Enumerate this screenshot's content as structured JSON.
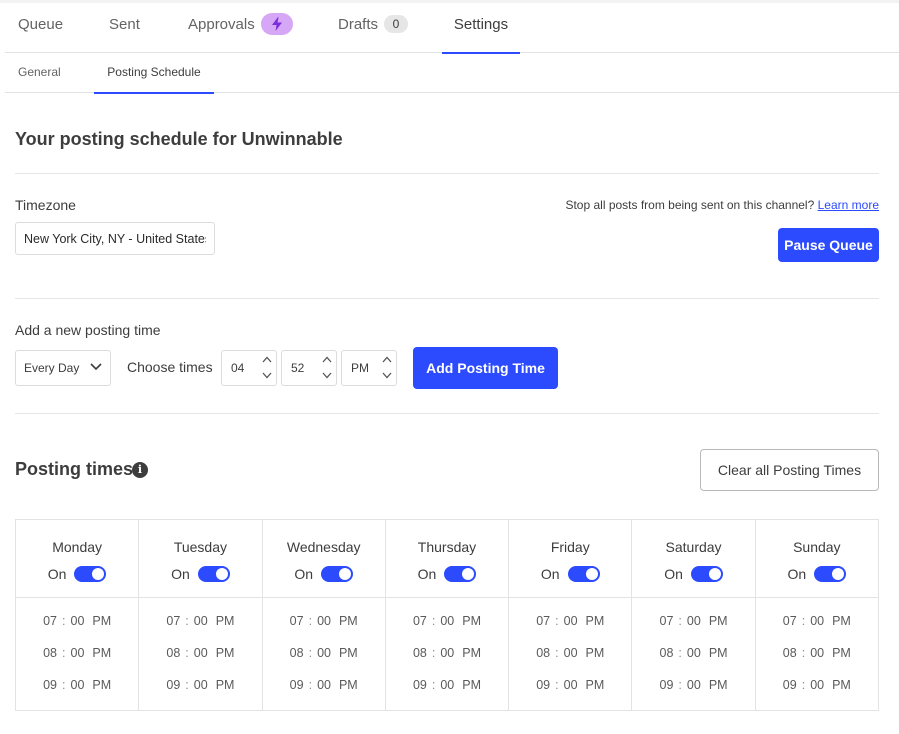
{
  "tabs": {
    "queue": "Queue",
    "sent": "Sent",
    "approvals": "Approvals",
    "drafts": "Drafts",
    "drafts_count": "0",
    "settings": "Settings"
  },
  "subtabs": {
    "general": "General",
    "posting_schedule": "Posting Schedule"
  },
  "page_title": "Your posting schedule for Unwinnable",
  "timezone": {
    "label": "Timezone",
    "value": "New York City, NY - United States"
  },
  "queue_control": {
    "stop_text": "Stop all posts from being sent on this channel?",
    "learn_more": "Learn more",
    "pause_label": "Pause Queue"
  },
  "add_time": {
    "label": "Add a new posting time",
    "frequency": "Every Day",
    "choose_times_label": "Choose times",
    "hour": "04",
    "minute": "52",
    "ampm": "PM",
    "button": "Add Posting Time"
  },
  "posting_times": {
    "title": "Posting times",
    "info_glyph": "i",
    "clear_button": "Clear all Posting Times",
    "on_label": "On",
    "days": [
      {
        "name": "Monday",
        "times": [
          {
            "h": "07",
            "m": "00",
            "p": "PM"
          },
          {
            "h": "08",
            "m": "00",
            "p": "PM"
          },
          {
            "h": "09",
            "m": "00",
            "p": "PM"
          }
        ]
      },
      {
        "name": "Tuesday",
        "times": [
          {
            "h": "07",
            "m": "00",
            "p": "PM"
          },
          {
            "h": "08",
            "m": "00",
            "p": "PM"
          },
          {
            "h": "09",
            "m": "00",
            "p": "PM"
          }
        ]
      },
      {
        "name": "Wednesday",
        "times": [
          {
            "h": "07",
            "m": "00",
            "p": "PM"
          },
          {
            "h": "08",
            "m": "00",
            "p": "PM"
          },
          {
            "h": "09",
            "m": "00",
            "p": "PM"
          }
        ]
      },
      {
        "name": "Thursday",
        "times": [
          {
            "h": "07",
            "m": "00",
            "p": "PM"
          },
          {
            "h": "08",
            "m": "00",
            "p": "PM"
          },
          {
            "h": "09",
            "m": "00",
            "p": "PM"
          }
        ]
      },
      {
        "name": "Friday",
        "times": [
          {
            "h": "07",
            "m": "00",
            "p": "PM"
          },
          {
            "h": "08",
            "m": "00",
            "p": "PM"
          },
          {
            "h": "09",
            "m": "00",
            "p": "PM"
          }
        ]
      },
      {
        "name": "Saturday",
        "times": [
          {
            "h": "07",
            "m": "00",
            "p": "PM"
          },
          {
            "h": "08",
            "m": "00",
            "p": "PM"
          },
          {
            "h": "09",
            "m": "00",
            "p": "PM"
          }
        ]
      },
      {
        "name": "Sunday",
        "times": [
          {
            "h": "07",
            "m": "00",
            "p": "PM"
          },
          {
            "h": "08",
            "m": "00",
            "p": "PM"
          },
          {
            "h": "09",
            "m": "00",
            "p": "PM"
          }
        ]
      }
    ]
  },
  "colors": {
    "accent": "#2c4bff",
    "approvals_badge": "#d6a6f7"
  },
  "icons": {
    "approvals": "lightning-bolt-icon",
    "frequency": "chevron-down-icon",
    "info": "info-icon",
    "spinner": "chevron-up-down-icon",
    "toggle": "toggle-switch"
  }
}
